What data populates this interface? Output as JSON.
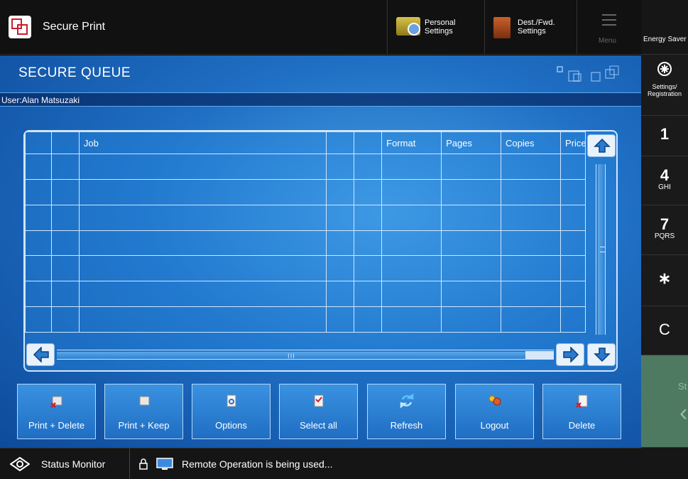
{
  "header": {
    "app_title": "Secure Print",
    "personal_settings": [
      "Personal",
      "Settings"
    ],
    "dest_settings": [
      "Dest./Fwd.",
      "Settings"
    ],
    "menu_label": "Menu"
  },
  "right_panel": {
    "energy_saver": "Energy Saver",
    "settings_registration": [
      "Settings/",
      "Registration"
    ],
    "keys": [
      {
        "main": "1",
        "sub": ""
      },
      {
        "main": "4",
        "sub": "GHI"
      },
      {
        "main": "7",
        "sub": "PQRS"
      },
      {
        "main": "∗",
        "sub": ""
      },
      {
        "main": "C",
        "sub": ""
      }
    ],
    "start_label": "St",
    "start_arrow": "‹"
  },
  "queue": {
    "title": "SECURE QUEUE",
    "user_label": "User:Alan Matsuzaki",
    "columns": [
      "",
      "",
      "Job",
      "",
      "",
      "Format",
      "Pages",
      "Copies",
      "Price"
    ],
    "rows": [
      [
        "",
        "",
        "",
        "",
        "",
        "",
        "",
        "",
        ""
      ],
      [
        "",
        "",
        "",
        "",
        "",
        "",
        "",
        "",
        ""
      ],
      [
        "",
        "",
        "",
        "",
        "",
        "",
        "",
        "",
        ""
      ],
      [
        "",
        "",
        "",
        "",
        "",
        "",
        "",
        "",
        ""
      ],
      [
        "",
        "",
        "",
        "",
        "",
        "",
        "",
        "",
        ""
      ],
      [
        "",
        "",
        "",
        "",
        "",
        "",
        "",
        "",
        ""
      ],
      [
        "",
        "",
        "",
        "",
        "",
        "",
        "",
        "",
        ""
      ]
    ],
    "hscroll_grip": "III"
  },
  "actions": [
    {
      "label": "Print + Delete",
      "icon": "print-delete-icon"
    },
    {
      "label": "Print + Keep",
      "icon": "print-keep-icon"
    },
    {
      "label": "Options",
      "icon": "options-icon"
    },
    {
      "label": "Select all",
      "icon": "select-all-icon"
    },
    {
      "label": "Refresh",
      "icon": "refresh-icon"
    },
    {
      "label": "Logout",
      "icon": "logout-icon"
    },
    {
      "label": "Delete",
      "icon": "delete-icon"
    }
  ],
  "status_bar": {
    "status_monitor": "Status Monitor",
    "message": "Remote Operation is being used..."
  },
  "colors": {
    "accent_blue": "#1f6fc4",
    "start_green": "#4e7a62",
    "bar_dark": "#111111"
  }
}
